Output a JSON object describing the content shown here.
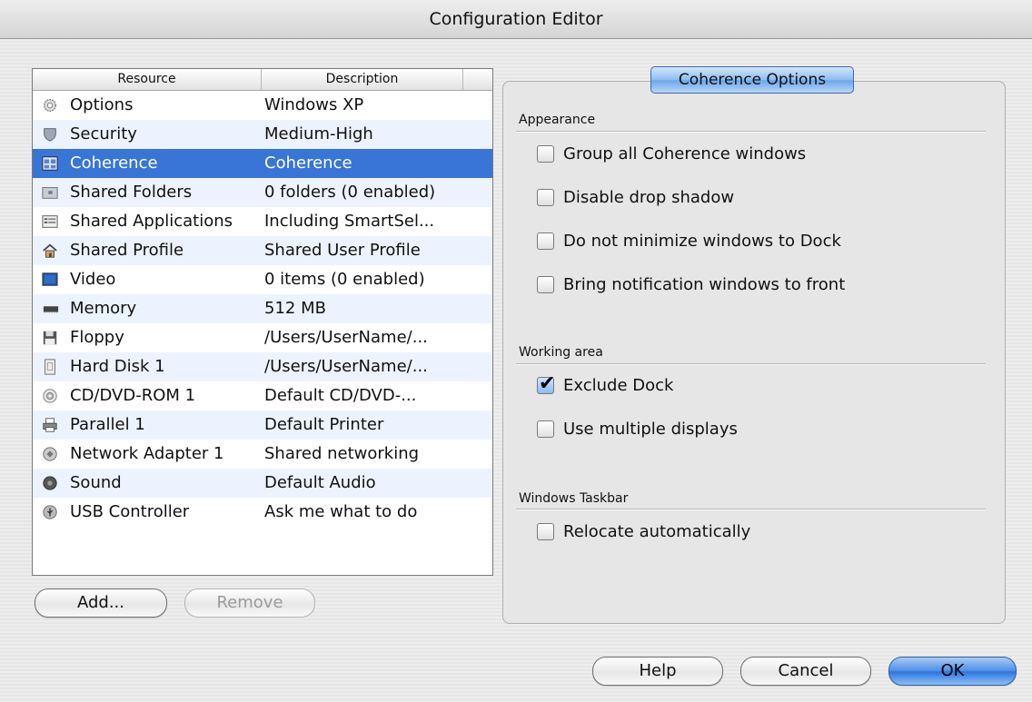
{
  "window": {
    "title": "Configuration Editor"
  },
  "list": {
    "columns": [
      "Resource",
      "Description"
    ],
    "rows": [
      {
        "resource": "Options",
        "description": "Windows XP",
        "icon": "gear-icon"
      },
      {
        "resource": "Security",
        "description": "Medium-High",
        "icon": "shield-icon"
      },
      {
        "resource": "Coherence",
        "description": "Coherence",
        "icon": "coherence-icon",
        "selected": true
      },
      {
        "resource": "Shared Folders",
        "description": "0 folders (0 enabled)",
        "icon": "folder-icon"
      },
      {
        "resource": "Shared Applications",
        "description": "Including SmartSel...",
        "icon": "applications-icon"
      },
      {
        "resource": "Shared Profile",
        "description": "Shared User Profile",
        "icon": "house-icon"
      },
      {
        "resource": "Video",
        "description": "0 items (0 enabled)",
        "icon": "monitor-icon"
      },
      {
        "resource": "Memory",
        "description": "512 MB",
        "icon": "memory-icon"
      },
      {
        "resource": "Floppy",
        "description": "/Users/UserName/...",
        "icon": "floppy-icon"
      },
      {
        "resource": "Hard Disk 1",
        "description": "/Users/UserName/...",
        "icon": "hard-disk-icon"
      },
      {
        "resource": "CD/DVD-ROM 1",
        "description": "Default CD/DVD-...",
        "icon": "cd-icon"
      },
      {
        "resource": "Parallel 1",
        "description": "Default Printer",
        "icon": "printer-icon"
      },
      {
        "resource": "Network Adapter 1",
        "description": "Shared networking",
        "icon": "network-icon"
      },
      {
        "resource": "Sound",
        "description": "Default Audio",
        "icon": "speaker-icon"
      },
      {
        "resource": "USB Controller",
        "description": "Ask me what to do",
        "icon": "usb-icon"
      }
    ]
  },
  "list_buttons": {
    "add": "Add...",
    "remove": "Remove"
  },
  "coherence": {
    "tab": "Coherence Options",
    "appearance": {
      "title": "Appearance",
      "options": [
        {
          "label": "Group all Coherence windows",
          "checked": false
        },
        {
          "label": "Disable drop shadow",
          "checked": false
        },
        {
          "label": "Do not minimize windows to Dock",
          "checked": false
        },
        {
          "label": "Bring notification windows to front",
          "checked": false
        }
      ]
    },
    "working_area": {
      "title": "Working area",
      "options": [
        {
          "label": "Exclude Dock",
          "checked": true
        },
        {
          "label": "Use multiple displays",
          "checked": false
        }
      ]
    },
    "taskbar": {
      "title": "Windows Taskbar",
      "options": [
        {
          "label": "Relocate automatically",
          "checked": false
        }
      ]
    }
  },
  "dialog_buttons": {
    "help": "Help",
    "cancel": "Cancel",
    "ok": "OK"
  },
  "colors": {
    "selection": "#3875d7",
    "stripe": "#edf3fe",
    "accent": "#4a8ee8"
  }
}
